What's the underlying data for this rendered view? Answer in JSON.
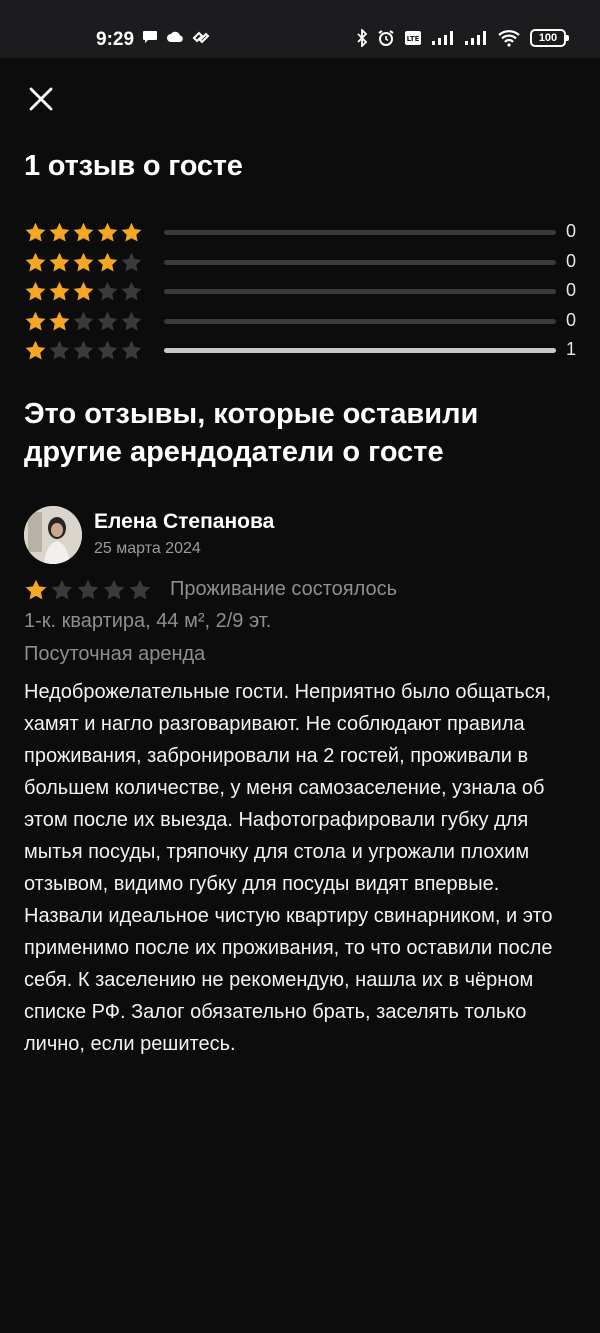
{
  "status_bar": {
    "time": "9:29",
    "battery": "100",
    "icons_left": [
      "message-icon",
      "cloud-icon",
      "app-icon"
    ],
    "icons_right": [
      "bluetooth-icon",
      "alarm-icon",
      "volte-icon",
      "signal-icon",
      "signal-icon",
      "wifi-icon",
      "battery-icon"
    ]
  },
  "header": {
    "title": "1 отзыв о госте"
  },
  "rating_summary": [
    {
      "stars": 5,
      "count": "0",
      "fraction": 0
    },
    {
      "stars": 4,
      "count": "0",
      "fraction": 0
    },
    {
      "stars": 3,
      "count": "0",
      "fraction": 0
    },
    {
      "stars": 2,
      "count": "0",
      "fraction": 0
    },
    {
      "stars": 1,
      "count": "1",
      "fraction": 1
    }
  ],
  "section": {
    "subtitle": "Это отзывы, которые оставили другие арендодатели о госте"
  },
  "review": {
    "author": "Елена Степанова",
    "date": "25 марта 2024",
    "rating": 1,
    "stay_status": "Проживание состоялось",
    "apartment": "1-к. квартира, 44 м², 2/9 эт.",
    "rent_type": "Посуточная аренда",
    "text": "Недоброжелательные гости. Неприятно было общаться, хамят и нагло разговаривают. Не соблюдают правила проживания, забронировали на 2 гостей, проживали в большем количестве, у меня самозаселение, узнала об этом после их выезда. Нафотографировали губку для мытья посуды, тряпочку для стола  и угрожали плохим отзывом, видимо губку для посуды видят впервые. Назвали идеальное чистую квартиру свинарником, и это применимо после их проживания, то что  оставили после себя. К заселению не рекомендую, нашла их в чёрном списке РФ. Залог обязательно брать, заселять только лично, если решитесь."
  },
  "colors": {
    "star_filled": "#f5a623",
    "star_empty": "#3a3a3c",
    "background": "#0c0c0c",
    "bar_fill": "#c7c7c7"
  }
}
